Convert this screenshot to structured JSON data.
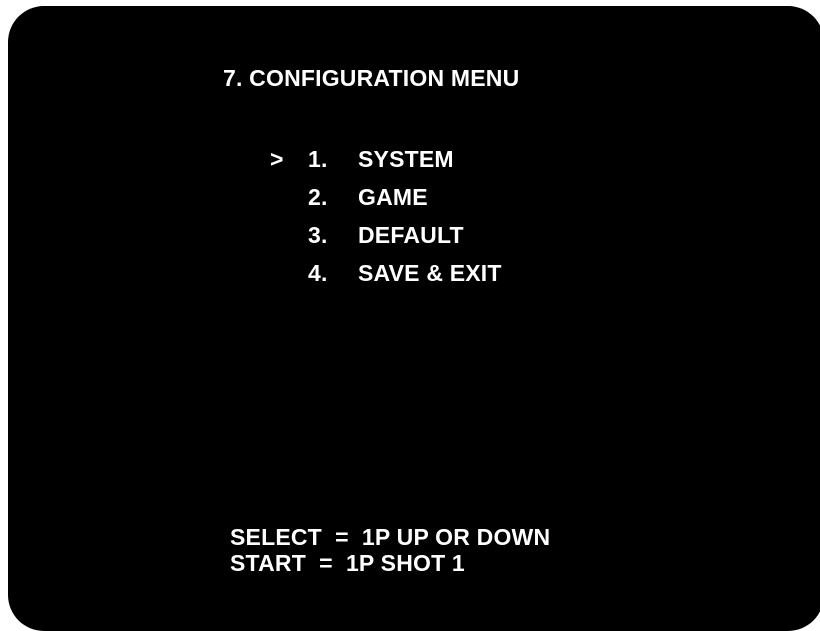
{
  "screen": {
    "title": "7. CONFIGURATION MENU",
    "cursor": ">",
    "menu": [
      {
        "number": "1.",
        "label": "SYSTEM"
      },
      {
        "number": "2.",
        "label": "GAME"
      },
      {
        "number": "3.",
        "label": "DEFAULT"
      },
      {
        "number": "4.",
        "label": "SAVE & EXIT"
      }
    ],
    "selected_index": 0,
    "help": [
      "SELECT  =  1P UP OR DOWN",
      "START  =  1P SHOT 1"
    ]
  },
  "colors": {
    "background": "#000000",
    "text": "#ffffff"
  }
}
